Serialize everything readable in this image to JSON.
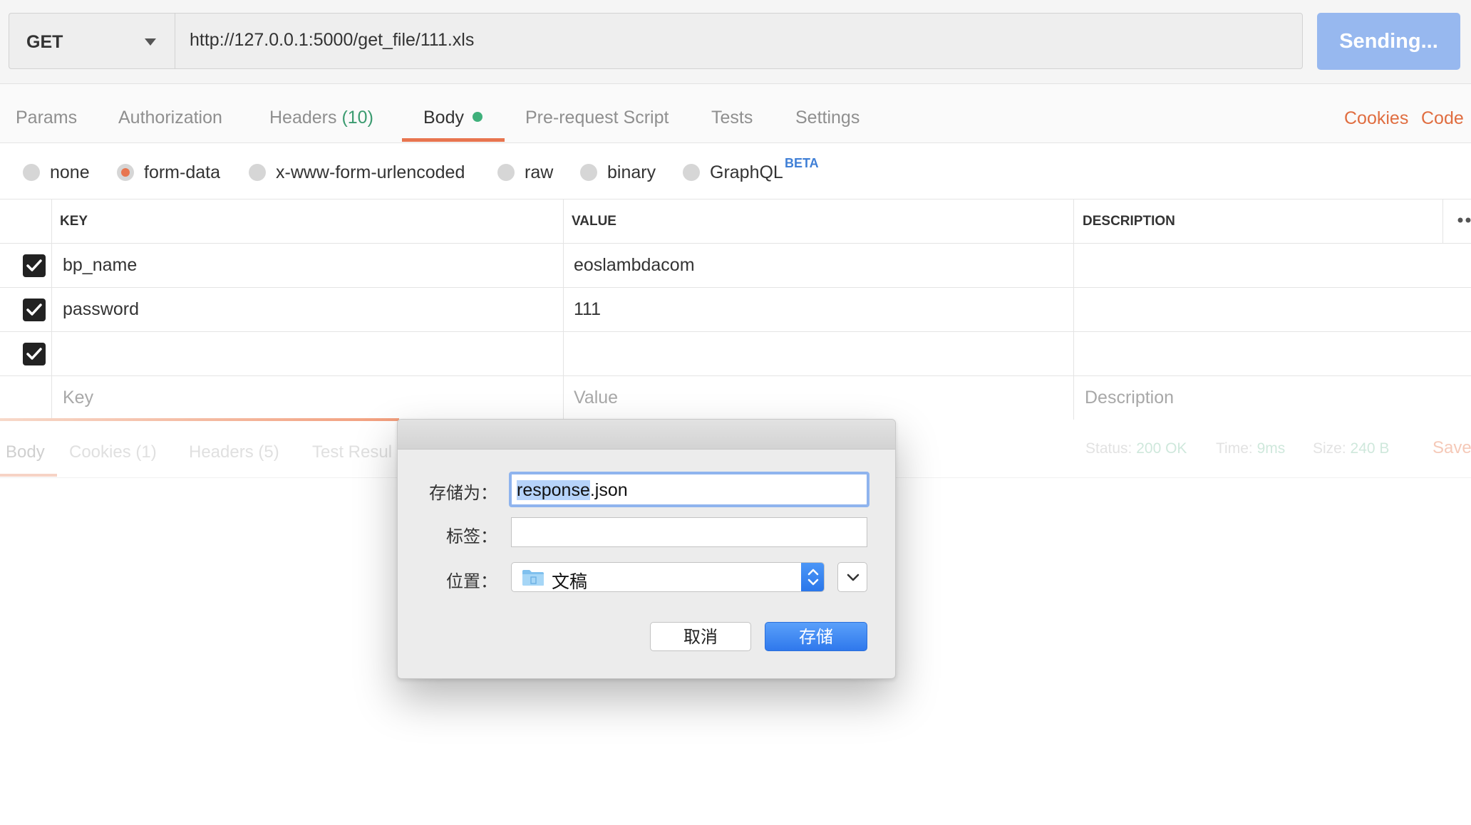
{
  "request": {
    "method": "GET",
    "url": "http://127.0.0.1:5000/get_file/111.xls",
    "send_label": "Sending..."
  },
  "tabs": {
    "params": "Params",
    "authorization": "Authorization",
    "headers": "Headers",
    "headers_count": "(10)",
    "body": "Body",
    "prerequest": "Pre-request Script",
    "tests": "Tests",
    "settings": "Settings",
    "cookies": "Cookies",
    "code": "Code"
  },
  "body_types": {
    "none": "none",
    "form_data": "form-data",
    "urlencoded": "x-www-form-urlencoded",
    "raw": "raw",
    "binary": "binary",
    "graphql": "GraphQL",
    "beta": "BETA",
    "selected": "form-data"
  },
  "table": {
    "headers": {
      "key": "KEY",
      "value": "VALUE",
      "description": "DESCRIPTION"
    },
    "rows": [
      {
        "checked": true,
        "key": "bp_name",
        "value": "eoslambdacom",
        "description": ""
      },
      {
        "checked": true,
        "key": "password",
        "value": "111",
        "description": ""
      },
      {
        "checked": true,
        "key": "",
        "value": "",
        "description": ""
      }
    ],
    "placeholders": {
      "key": "Key",
      "value": "Value",
      "description": "Description"
    }
  },
  "response": {
    "tabs": {
      "body": "Body",
      "cookies": "Cookies",
      "cookies_count": "(1)",
      "headers": "Headers",
      "headers_count": "(5)",
      "test_results": "Test Resul"
    },
    "status_label": "Status:",
    "status_value": "200 OK",
    "time_label": "Time:",
    "time_value": "9ms",
    "size_label": "Size:",
    "size_value": "240 B",
    "save": "Save"
  },
  "dialog": {
    "save_as_label": "存储为：",
    "filename_selected": "response",
    "filename_ext": ".json",
    "tags_label": "标签：",
    "tags_value": "",
    "location_label": "位置：",
    "location_value": "文稿",
    "cancel": "取消",
    "save": "存储"
  },
  "colors": {
    "accent_orange": "#e8754f",
    "send_button": "#97b8ef",
    "primary_blue": "#2f78ec",
    "count_green": "#3b9b70"
  }
}
